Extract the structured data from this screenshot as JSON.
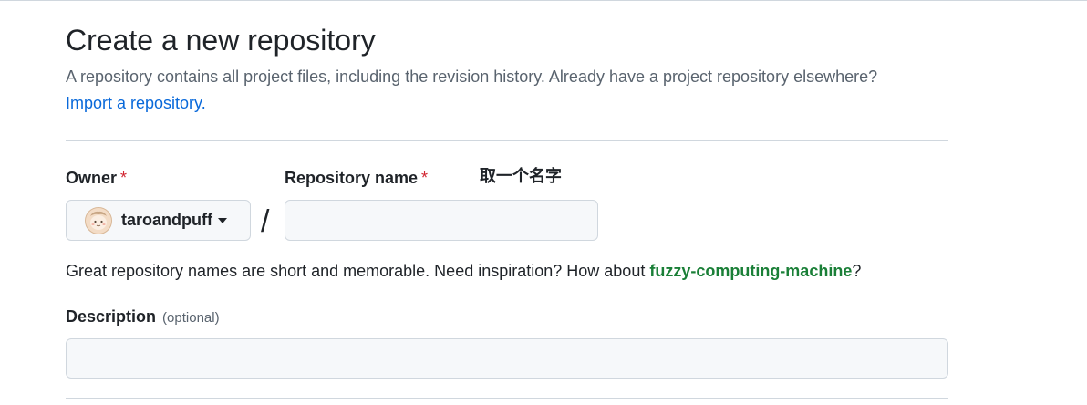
{
  "header": {
    "title": "Create a new repository",
    "subtitle": "A repository contains all project files, including the revision history. Already have a project repository elsewhere?",
    "import_link": "Import a repository."
  },
  "owner": {
    "label": "Owner",
    "required_mark": "*",
    "selected": "taroandpuff",
    "avatar_icon": "avatar-icon"
  },
  "separator": "/",
  "repository_name": {
    "label": "Repository name",
    "required_mark": "*",
    "value": "",
    "annotation": "取一个名字"
  },
  "hint": {
    "prefix": "Great repository names are short and memorable. Need inspiration? How about ",
    "suggestion": "fuzzy-computing-machine",
    "suffix": "?"
  },
  "description": {
    "label": "Description",
    "optional": "(optional)",
    "value": ""
  },
  "colors": {
    "link": "#0969da",
    "required": "#d1242f",
    "suggestion": "#1a7f37",
    "input_bg": "#f6f8fa",
    "border": "#d0d7de"
  }
}
